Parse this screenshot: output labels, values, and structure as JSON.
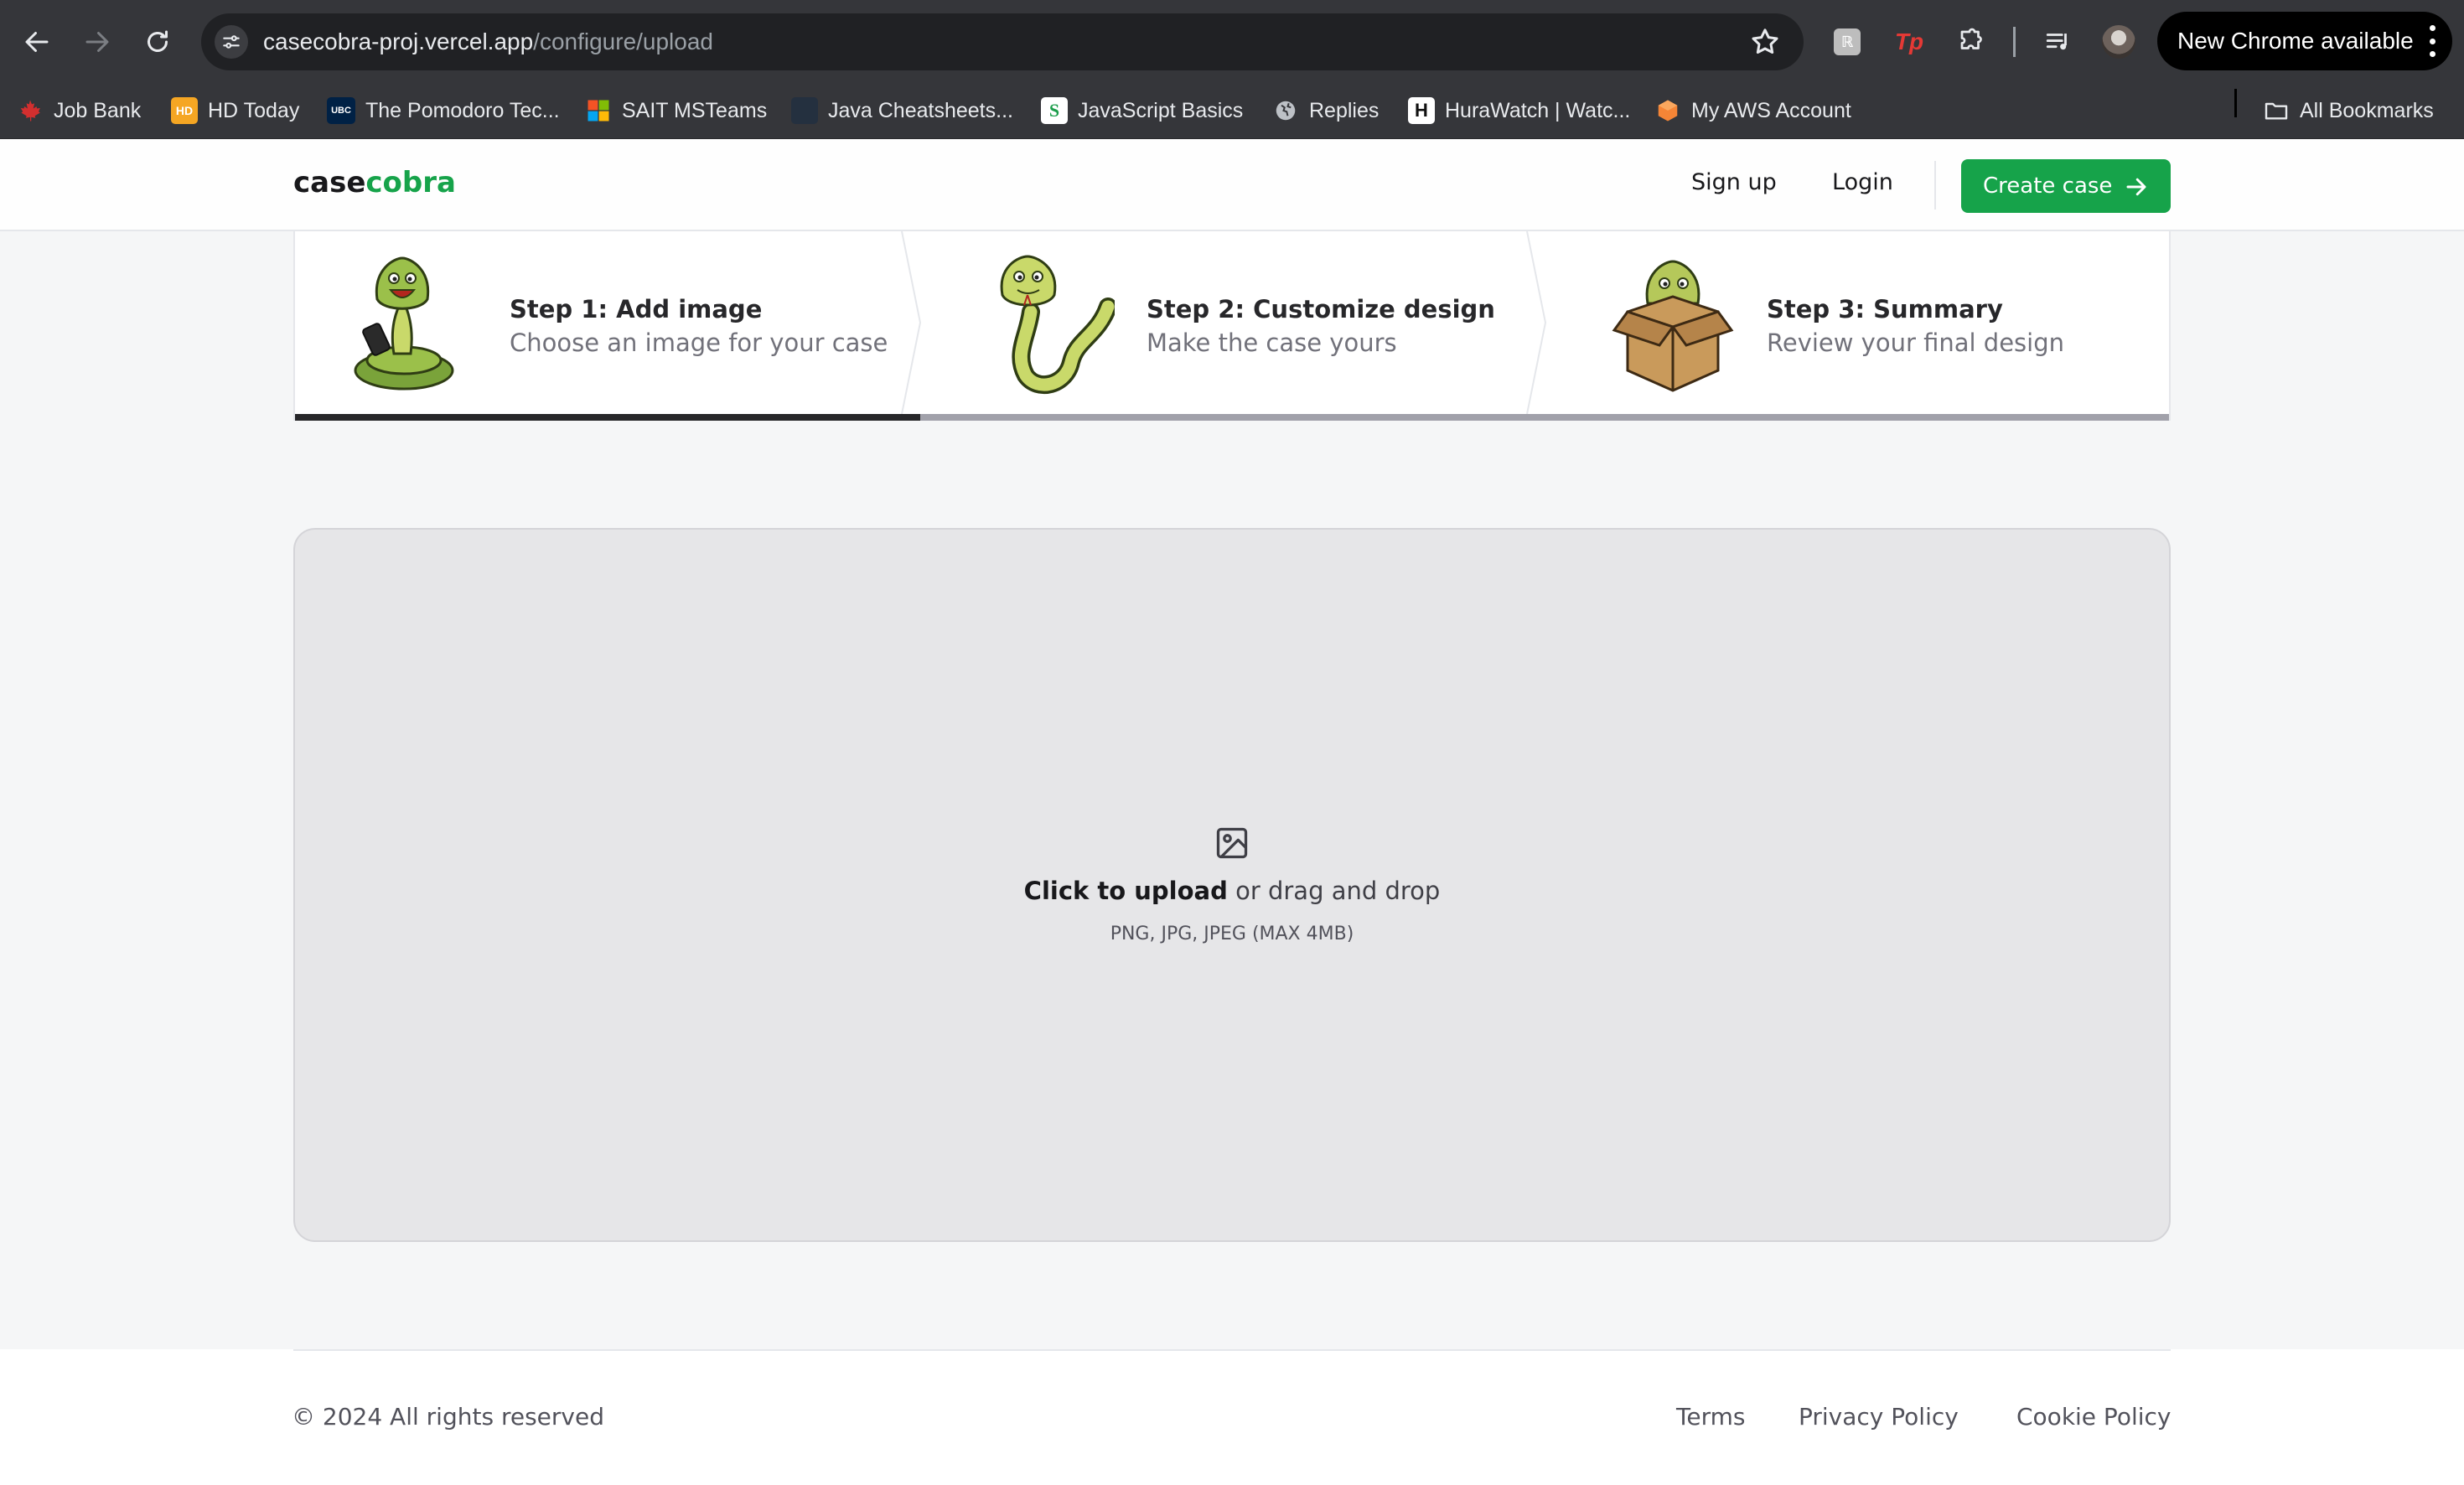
{
  "browser": {
    "url_host": "casecobra-proj.vercel.app",
    "url_path": "/configure/upload",
    "update_label": "New Chrome available",
    "bookmarks": [
      {
        "label": "Job Bank",
        "icon": "maple-leaf-icon"
      },
      {
        "label": "HD Today",
        "icon": "hd-icon",
        "badge": "HD"
      },
      {
        "label": "The Pomodoro Tec...",
        "icon": "ubc-icon",
        "badge": "UBC"
      },
      {
        "label": "SAIT MSTeams",
        "icon": "microsoft-icon"
      },
      {
        "label": "Java Cheatsheets...",
        "icon": "java-icon"
      },
      {
        "label": "JavaScript Basics",
        "icon": "javascript-basics-icon",
        "badge": "S"
      },
      {
        "label": "Replies",
        "icon": "globe-icon"
      },
      {
        "label": "HuraWatch | Watc...",
        "icon": "hurawatch-icon",
        "badge": "H"
      },
      {
        "label": "My AWS Account",
        "icon": "aws-icon"
      }
    ],
    "all_bookmarks_label": "All Bookmarks"
  },
  "header": {
    "logo_main": "case",
    "logo_accent": "cobra",
    "signup_label": "Sign up",
    "login_label": "Login",
    "cta_label": "Create case"
  },
  "steps": [
    {
      "title": "Step 1: Add image",
      "description": "Choose an image for your case",
      "status": "current"
    },
    {
      "title": "Step 2: Customize design",
      "description": "Make the case yours",
      "status": "upcoming"
    },
    {
      "title": "Step 3: Summary",
      "description": "Review your final design",
      "status": "upcoming"
    }
  ],
  "upload": {
    "action_label": "Click to upload",
    "rest_label": " or drag and drop",
    "formats_label": "PNG, JPG, JPEG (MAX 4MB)"
  },
  "footer": {
    "copyright": "© 2024 All rights reserved",
    "links": [
      "Terms",
      "Privacy Policy",
      "Cookie Policy"
    ]
  },
  "colors": {
    "accent": "#16a34a",
    "chrome_toolbar": "#35363a",
    "active_step": "#27272a",
    "inactive_step": "#a1a1aa"
  }
}
